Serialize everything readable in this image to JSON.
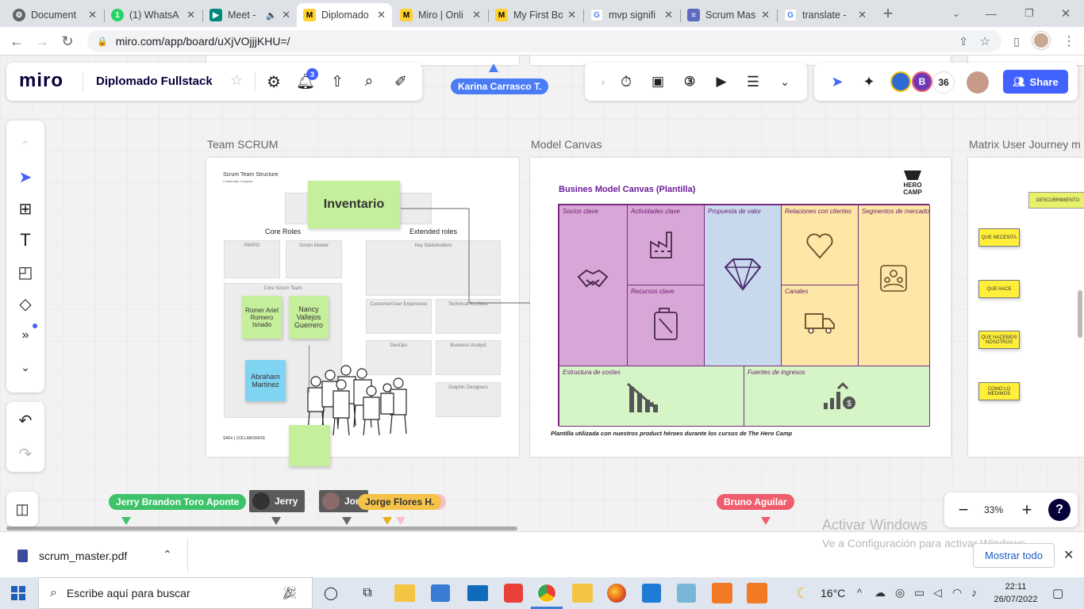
{
  "browser": {
    "tabs": [
      {
        "title": "Document",
        "icon": "gear-icon",
        "color": "#5f6368",
        "active": false
      },
      {
        "title": "(1) WhatsA",
        "icon": "whatsapp-icon",
        "color": "#25d366",
        "active": false
      },
      {
        "title": "Meet -",
        "icon": "meet-icon",
        "color": "#00897b",
        "active": false
      },
      {
        "title": "Diplomado",
        "icon": "miro-icon",
        "color": "#ffd02f",
        "active": true
      },
      {
        "title": "Miro | Onli",
        "icon": "miro-icon",
        "color": "#ffd02f",
        "active": false
      },
      {
        "title": "My First Bo",
        "icon": "miro-icon",
        "color": "#ffd02f",
        "active": false
      },
      {
        "title": "mvp signifi",
        "icon": "google-icon",
        "color": "#4285f4",
        "active": false
      },
      {
        "title": "Scrum Mas",
        "icon": "scrum-icon",
        "color": "#5c6bc0",
        "active": false
      },
      {
        "title": "translate -",
        "icon": "google-icon",
        "color": "#4285f4",
        "active": false
      }
    ],
    "url": "miro.com/app/board/uXjVOjjjKHU=/"
  },
  "miro": {
    "logo": "miro",
    "board_name": "Diplomado Fullstack",
    "notification_count": "3",
    "collaborator_count": "36",
    "avatar_letter": "B",
    "share_label": "Share",
    "zoom": "33%",
    "help": "?"
  },
  "cursors": {
    "karina": "Karina Carrasco T.",
    "jerry_full": "Jerry Brandon Toro Aponte",
    "jerry": "Jerry",
    "jon": "Jon",
    "jorge": "Jorge Flores H.",
    "bruno": "Bruno Aguilar"
  },
  "frames": {
    "scrum": {
      "label": "Team SCRUM",
      "title": "Scrum Team Structure",
      "subtitle": "Collaborate Template",
      "inventario": "Inventario",
      "core_roles": "Core Roles",
      "extended_roles": "Extended roles",
      "pm": "PM/PO",
      "scrum_master": "Scrum Master",
      "core_team": "Core Scrum Team",
      "key_stakeholders": "Key Stakeholders",
      "customer_ux": "Customer/User Experience",
      "tech_architect": "Technical Architect",
      "devops": "DevOps",
      "business_analyst": "Business Analyst",
      "graphic_designers": "Graphic Designers",
      "sticky1": "Romer Ariel Romero Isnado",
      "sticky2": "Nancy Vallejos Guerrero",
      "sticky3": "Abraham Martinez",
      "footer": "SAFe | COLLABORATE"
    },
    "canvas": {
      "label": "Model Canvas",
      "title": "Busines Model Canvas (Plantilla)",
      "brand": "HERO CAMP",
      "cells": {
        "socios": "Socios clave",
        "actividades": "Actividades clave",
        "propuesta": "Propuesta de valor",
        "relaciones": "Relaciones con clientes",
        "segmentos": "Segmentos de mercado",
        "recursos": "Recursos clave",
        "canales": "Canales",
        "costes": "Estructura de costes",
        "ingresos": "Fuentes de ingresos"
      },
      "footer": "Plantilla utilizada con  nuestros product héroes durante los cursos de The Hero Camp"
    },
    "journey": {
      "label": "Matrix User Journey m",
      "descubrimiento": "DESCUBRIMIENTO",
      "q1": "QUE NECESITA",
      "q2": "QUE HACE",
      "q3": "QUE HACEMOS NOSOTROS",
      "q4": "COMO LO MEDIMOS"
    }
  },
  "watermark": {
    "title": "Activar Windows",
    "subtitle": "Ve a Configuración para activar Windows."
  },
  "download": {
    "filename": "scrum_master.pdf",
    "show_all": "Mostrar todo"
  },
  "taskbar": {
    "search_placeholder": "Escribe aquí para buscar",
    "temperature": "16°C",
    "time": "22:11",
    "date": "26/07/2022"
  }
}
